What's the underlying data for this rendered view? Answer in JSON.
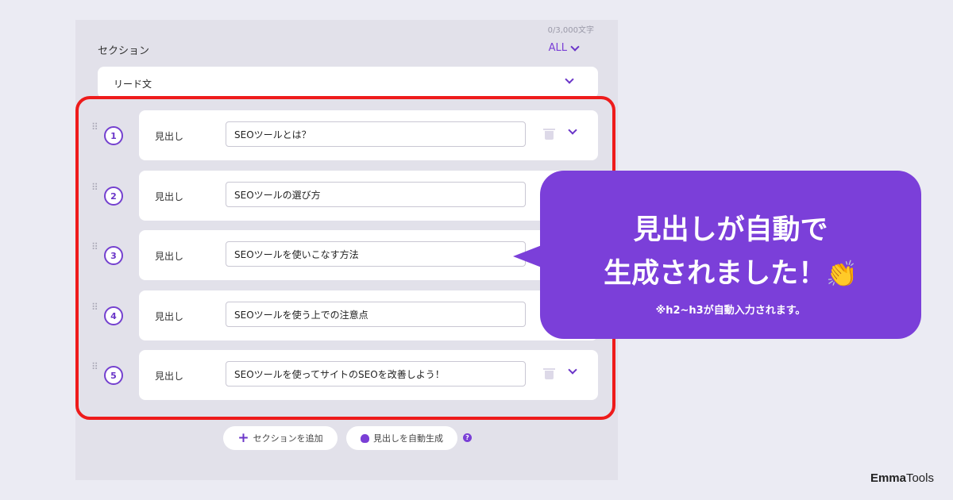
{
  "editor": {
    "char_count": "0/3,000文字",
    "section_label": "セクション",
    "all_label": "ALL",
    "lead_label": "リード文",
    "heading_label": "見出し",
    "headings": [
      {
        "num": "1",
        "value": "SEOツールとは？"
      },
      {
        "num": "2",
        "value": "SEOツールの選び方"
      },
      {
        "num": "3",
        "value": "SEOツールを使いこなす方法"
      },
      {
        "num": "4",
        "value": "SEOツールを使う上での注意点"
      },
      {
        "num": "5",
        "value": "SEOツールを使ってサイトのSEOを改善しよう！"
      }
    ],
    "add_section_label": "セクションを追加",
    "auto_generate_label": "見出しを自動生成",
    "help_glyph": "?"
  },
  "callout": {
    "line1": "見出しが自動で",
    "line2": "生成されました！",
    "emoji": "👏",
    "note": "※h2~h3が自動入力されます。"
  },
  "brand": {
    "part1": "Emma",
    "part2": "Tools"
  },
  "colors": {
    "accent": "#7b3fd9",
    "highlight_frame": "#ee1b1b",
    "panel_bg": "#e2e1ea"
  }
}
